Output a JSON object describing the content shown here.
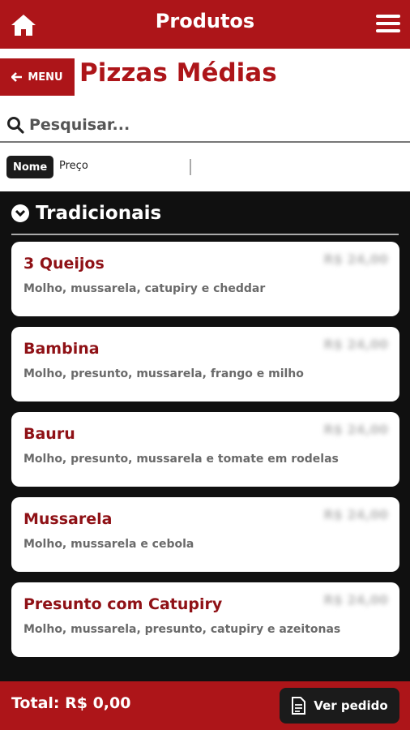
{
  "header": {
    "title": "Produtos",
    "home_icon": "home-icon",
    "menu_icon": "hamburger-menu-icon"
  },
  "nav": {
    "back_label": "MENU",
    "page_title": "Pizzas Médias"
  },
  "search": {
    "placeholder": "Pesquisar..."
  },
  "sort": {
    "nome_label": "Nome",
    "preco_label": "Preço"
  },
  "section": {
    "title": "Tradicionais"
  },
  "products": [
    {
      "name": "3 Queijos",
      "description": "Molho, mussarela, catupiry e cheddar",
      "price": "R$ 24,00"
    },
    {
      "name": "Bambina",
      "description": "Molho, presunto, mussarela, frango e milho",
      "price": "R$ 24,00"
    },
    {
      "name": "Bauru",
      "description": "Molho, presunto, mussarela e tomate em rodelas",
      "price": "R$ 24,00"
    },
    {
      "name": "Mussarela",
      "description": "Molho, mussarela e cebola",
      "price": "R$ 24,00"
    },
    {
      "name": "Presunto com Catupiry",
      "description": "Molho, mussarela, presunto, catupiry e azeitonas",
      "price": "R$ 24,00"
    }
  ],
  "footer": {
    "total_label": "Total: R$ 0,00",
    "order_label": "Ver pedido"
  },
  "colors": {
    "brand_red": "#ad1519",
    "dark": "#101010",
    "product_name": "#8f1116"
  }
}
